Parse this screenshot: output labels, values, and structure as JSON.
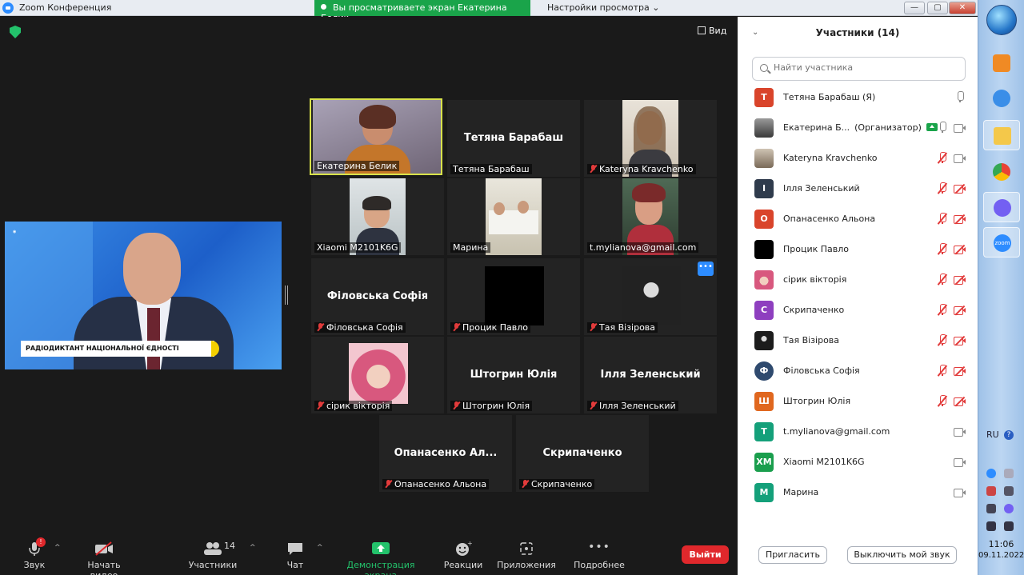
{
  "window": {
    "title": "Zoom Конференция",
    "share_banner": "Вы просматриваете экран Екатерина Белик",
    "view_settings": "Настройки просмотра",
    "minimize": "—",
    "maximize": "▢",
    "close": "✕"
  },
  "meeting": {
    "view_label": "Вид",
    "shared_screen": {
      "lower_third": "РАДІОДИКТАНТ НАЦІОНАЛЬНОЇ ЄДНОСТІ"
    },
    "tile_menu": "•••",
    "tiles": [
      {
        "label": "Екатерина Белик",
        "big": ""
      },
      {
        "label": "Тетяна Барабаш",
        "big": "Тетяна Барабаш"
      },
      {
        "label": "Kateryna Kravchenko",
        "big": ""
      },
      {
        "label": "Xiaomi M2101K6G",
        "big": ""
      },
      {
        "label": "Марина",
        "big": ""
      },
      {
        "label": "t.mylianova@gmail.com",
        "big": ""
      },
      {
        "label": "Філовська Софія",
        "big": "Філовська Софія"
      },
      {
        "label": "Процик Павло",
        "big": ""
      },
      {
        "label": "Тая Візірова",
        "big": ""
      },
      {
        "label": "сірик вікторія",
        "big": ""
      },
      {
        "label": "Штогрин Юлія",
        "big": "Штогрин Юлія"
      },
      {
        "label": "Ілля Зеленський",
        "big": "Ілля Зеленський"
      },
      {
        "label": "Опанасенко Альона",
        "big": "Опанасенко  Ал..."
      },
      {
        "label": "Скрипаченко",
        "big": "Скрипаченко"
      }
    ]
  },
  "toolbar": {
    "audio": "Звук",
    "audio_badge": "!",
    "video": "Начать видео",
    "participants": "Участники",
    "participants_count": "14",
    "chat": "Чат",
    "share": "Демонстрация экрана",
    "reactions": "Реакции",
    "apps": "Приложения",
    "more": "Подробнее",
    "more_dots": "•••",
    "leave": "Выйти"
  },
  "participants_panel": {
    "title": "Участники (14)",
    "search_placeholder": "Найти участника",
    "invite": "Пригласить",
    "mute_me": "Выключить мой звук",
    "rows": [
      {
        "initial": "Т",
        "name": "Тетяна Барабаш (Я)",
        "role": "",
        "color": "#d9442b"
      },
      {
        "initial": "",
        "name": "Екатерина Б...",
        "role": "(Организатор)",
        "color": "#555555"
      },
      {
        "initial": "",
        "name": "Kateryna Kravchenko",
        "role": "",
        "color": "#8a7f70"
      },
      {
        "initial": "І",
        "name": "Ілля Зеленський",
        "role": "",
        "color": "#2f3b4c"
      },
      {
        "initial": "О",
        "name": "Опанасенко Альона",
        "role": "",
        "color": "#d9442b"
      },
      {
        "initial": "",
        "name": "Процик Павло",
        "role": "",
        "color": "#000000"
      },
      {
        "initial": "",
        "name": "сірик вікторія",
        "role": "",
        "color": "#e8a0b4"
      },
      {
        "initial": "С",
        "name": "Скрипаченко",
        "role": "",
        "color": "#8e3fbf"
      },
      {
        "initial": "",
        "name": "Тая Візірова",
        "role": "",
        "color": "#1c1c1c"
      },
      {
        "initial": "Ф",
        "name": "Філовська Софія",
        "role": "",
        "color": "#2f4a6e"
      },
      {
        "initial": "Ш",
        "name": "Штогрин Юлія",
        "role": "",
        "color": "#e0671f"
      },
      {
        "initial": "T",
        "name": "t.mylianova@gmail.com",
        "role": "",
        "color": "#14a07a"
      },
      {
        "initial": "ХМ",
        "name": "Xiaomi M2101K6G",
        "role": "",
        "color": "#1a9e4d"
      },
      {
        "initial": "М",
        "name": "Марина",
        "role": "",
        "color": "#14a07a"
      }
    ]
  },
  "taskbar": {
    "lang": "RU",
    "help": "?",
    "time": "11:06",
    "date": "09.11.2022",
    "zoom_label": "zoom"
  }
}
